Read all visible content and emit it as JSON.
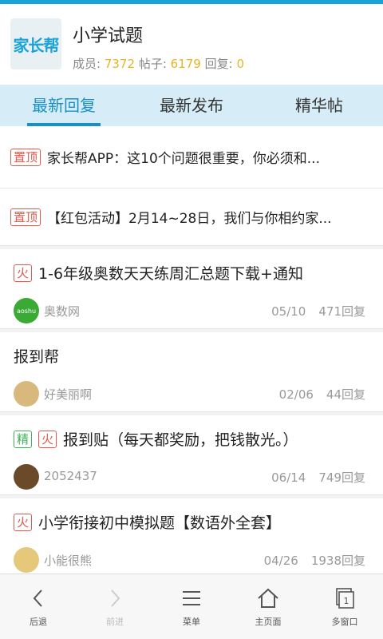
{
  "header": {
    "logo_text": "家长帮",
    "title": "小学试题",
    "members_label": "成员:",
    "members": "7372",
    "posts_label": "帖子:",
    "posts": "6179",
    "replies_label": "回复:",
    "replies": "0"
  },
  "tabs": [
    {
      "label": "最新回复",
      "active": true
    },
    {
      "label": "最新发布",
      "active": false
    },
    {
      "label": "精华帖",
      "active": false
    }
  ],
  "pinned": [
    {
      "badge": "置顶",
      "title": "家长帮APP：这10个问题很重要，你必须和..."
    },
    {
      "badge": "置顶",
      "title": "【红包活动】2月14~28日，我们与你相约家..."
    }
  ],
  "posts": [
    {
      "badges": [
        "火"
      ],
      "title": "1-6年级奥数天天练周汇总题下载+通知",
      "author": "奥数网",
      "date": "05/10",
      "replies": "471回复",
      "avatar_color": "#3aaa35",
      "avatar_text": "aoshu"
    },
    {
      "badges": [],
      "title": "报到帮",
      "author": "好美丽啊",
      "date": "02/06",
      "replies": "44回复",
      "avatar_color": "#d9b87c",
      "avatar_text": ""
    },
    {
      "badges": [
        "精",
        "火"
      ],
      "title": "报到贴（每天都奖励，把钱散光。）",
      "author": "2052437",
      "date": "06/14",
      "replies": "749回复",
      "avatar_color": "#6b4a2a",
      "avatar_text": ""
    },
    {
      "badges": [
        "火"
      ],
      "title": "小学衔接初中模拟题【数语外全套】",
      "author": "小能很熊",
      "date": "04/26",
      "replies": "1938回复",
      "avatar_color": "#e6c87a",
      "avatar_text": ""
    }
  ],
  "bottom_nav": [
    {
      "label": "后退",
      "icon": "back-icon",
      "enabled": true
    },
    {
      "label": "前进",
      "icon": "forward-icon",
      "enabled": false
    },
    {
      "label": "菜单",
      "icon": "menu-icon",
      "enabled": true
    },
    {
      "label": "主页面",
      "icon": "home-icon",
      "enabled": true
    },
    {
      "label": "多窗口",
      "icon": "windows-icon",
      "enabled": true,
      "count": "1"
    }
  ]
}
